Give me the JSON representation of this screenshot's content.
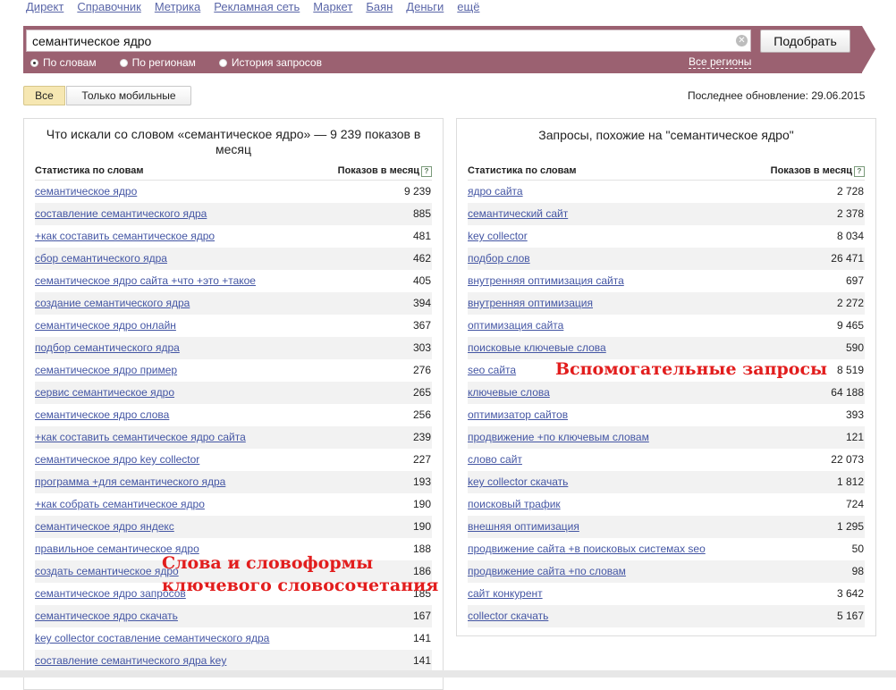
{
  "topnav": [
    "Директ",
    "Справочник",
    "Метрика",
    "Рекламная сеть",
    "Маркет",
    "Баян",
    "Деньги",
    "ещё"
  ],
  "search": {
    "value": "семантическое ядро",
    "button": "Подобрать",
    "clear_glyph": "✕",
    "modes": [
      "По словам",
      "По регионам",
      "История запросов"
    ],
    "selected_mode": "По словам",
    "regions_link": "Все регионы"
  },
  "filters": {
    "all": "Все",
    "mobile": "Только мобильные",
    "selected": "Все"
  },
  "last_update": "Последнее обновление: 29.06.2015",
  "left": {
    "title": "Что искали со словом «семантическое ядро» — 9 239 показов в месяц",
    "col_words": "Статистика по словам",
    "col_shows": "Показов в месяц",
    "help": "?",
    "rows": [
      {
        "q": "семантическое ядро",
        "n": "9 239"
      },
      {
        "q": "составление семантического ядра",
        "n": "885"
      },
      {
        "q": "+как составить семантическое ядро",
        "n": "481"
      },
      {
        "q": "сбор семантического ядра",
        "n": "462"
      },
      {
        "q": "семантическое ядро сайта +что +это +такое",
        "n": "405"
      },
      {
        "q": "создание семантического ядра",
        "n": "394"
      },
      {
        "q": "семантическое ядро онлайн",
        "n": "367"
      },
      {
        "q": "подбор семантического ядра",
        "n": "303"
      },
      {
        "q": "семантическое ядро пример",
        "n": "276"
      },
      {
        "q": "сервис семантическое ядро",
        "n": "265"
      },
      {
        "q": "семантическое ядро слова",
        "n": "256"
      },
      {
        "q": "+как составить семантическое ядро сайта",
        "n": "239"
      },
      {
        "q": "семантическое ядро key collector",
        "n": "227"
      },
      {
        "q": "программа +для семантического ядра",
        "n": "193"
      },
      {
        "q": "+как собрать семантическое ядро",
        "n": "190"
      },
      {
        "q": "семантическое ядро яндекс",
        "n": "190"
      },
      {
        "q": "правильное семантическое ядро",
        "n": "188"
      },
      {
        "q": "создать семантическое ядро",
        "n": "186"
      },
      {
        "q": "семантическое ядро запросов",
        "n": "185"
      },
      {
        "q": "семантическое ядро скачать",
        "n": "167"
      },
      {
        "q": "key collector составление семантического ядра",
        "n": "141"
      },
      {
        "q": "составление семантического ядра key",
        "n": "141"
      }
    ]
  },
  "right": {
    "title": "Запросы, похожие на \"семантическое ядро\"",
    "col_words": "Статистика по словам",
    "col_shows": "Показов в месяц",
    "help": "?",
    "rows": [
      {
        "q": "ядро сайта",
        "n": "2 728"
      },
      {
        "q": "семантический сайт",
        "n": "2 378"
      },
      {
        "q": "key collector",
        "n": "8 034"
      },
      {
        "q": "подбор слов",
        "n": "26 471"
      },
      {
        "q": "внутренняя оптимизация сайта",
        "n": "697"
      },
      {
        "q": "внутренняя оптимизация",
        "n": "2 272"
      },
      {
        "q": "оптимизация сайта",
        "n": "9 465"
      },
      {
        "q": "поисковые ключевые слова",
        "n": "590"
      },
      {
        "q": "seo сайта",
        "n": "8 519"
      },
      {
        "q": "ключевые слова",
        "n": "64 188"
      },
      {
        "q": "оптимизатор сайтов",
        "n": "393"
      },
      {
        "q": "продвижение +по ключевым словам",
        "n": "121"
      },
      {
        "q": "слово сайт",
        "n": "22 073"
      },
      {
        "q": "key collector скачать",
        "n": "1 812"
      },
      {
        "q": "поисковый трафик",
        "n": "724"
      },
      {
        "q": "внешняя оптимизация",
        "n": "1 295"
      },
      {
        "q": "продвижение сайта +в поисковых системах seo",
        "n": "50"
      },
      {
        "q": "продвижение сайта +по словам",
        "n": "98"
      },
      {
        "q": "сайт конкурент",
        "n": "3 642"
      },
      {
        "q": "collector скачать",
        "n": "5 167"
      }
    ]
  },
  "annotations": {
    "left_line1": "Слова и словоформы",
    "left_line2": "ключевого словосочетания",
    "right": "Вспомогательные запросы"
  },
  "colors": {
    "band": "#9b6171",
    "link": "#4456a4",
    "annotation": "#e21d1d",
    "active_filter": "#f6e7b2"
  }
}
